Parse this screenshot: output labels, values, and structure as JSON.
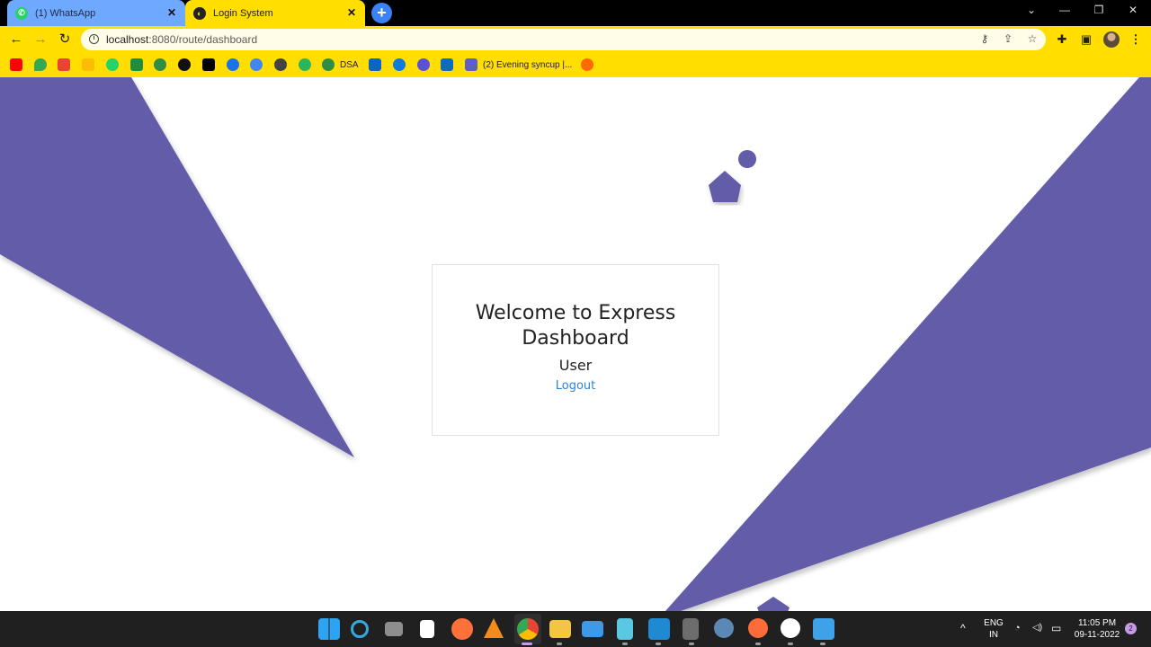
{
  "browser": {
    "tabs": [
      {
        "label": "(1) WhatsApp",
        "close": "✕"
      },
      {
        "label": "Login System",
        "close": "✕"
      }
    ],
    "new_tab": "+",
    "window_controls": {
      "chevron": "⌄",
      "minimize": "—",
      "restore": "❐",
      "close": "✕"
    },
    "nav": {
      "back": "←",
      "forward": "→",
      "reload": "↻"
    },
    "url_host": "localhost",
    "url_path": ":8080/route/dashboard",
    "omnibox_icons": {
      "key": "⚷",
      "share": "⇪",
      "star": "☆"
    },
    "toolbar_icons": {
      "extensions": "✚",
      "sidepanel": "▣"
    },
    "bookmarks": [
      {
        "name": "youtube",
        "color": "#ff0000"
      },
      {
        "name": "maps",
        "color": "#34a853"
      },
      {
        "name": "gmail",
        "color": "#ea4335"
      },
      {
        "name": "drive",
        "color": "#fbbc04"
      },
      {
        "name": "whatsapp",
        "color": "#25d366"
      },
      {
        "name": "classroom",
        "color": "#1e8e3e"
      },
      {
        "name": "gfg",
        "color": "#2f8d46"
      },
      {
        "name": "github",
        "color": "#111111"
      },
      {
        "name": "hackerrank",
        "color": "#000000"
      },
      {
        "name": "codechef",
        "color": "#1a73e8"
      },
      {
        "name": "webapp",
        "color": "#4285f4"
      },
      {
        "name": "idea",
        "color": "#444444"
      },
      {
        "name": "leetcode",
        "color": "#2db55d"
      },
      {
        "name": "gfg-dsa",
        "color": "#2f8d46",
        "label": "DSA"
      },
      {
        "name": "linkedin",
        "color": "#0a66c2"
      },
      {
        "name": "edge",
        "color": "#0c7bdc"
      },
      {
        "name": "messenger",
        "color": "#5b51d8"
      },
      {
        "name": "outlook",
        "color": "#0f6cbd"
      },
      {
        "name": "teams",
        "color": "#5b5fc7",
        "label": "(2) Evening syncup |..."
      },
      {
        "name": "fish",
        "color": "#ff6a00"
      }
    ]
  },
  "page": {
    "title": "Welcome to Express Dashboard",
    "user": "User",
    "logout": "Logout",
    "shape_color": "#625ca9"
  },
  "taskbar": {
    "apps": [
      {
        "name": "start",
        "color": "#2ea3f2"
      },
      {
        "name": "search",
        "color": "#34a8e0"
      },
      {
        "name": "task-view",
        "color": "#8e8e8e"
      },
      {
        "name": "notepad",
        "color": "#ffffff"
      },
      {
        "name": "firefox",
        "color": "#ff7139"
      },
      {
        "name": "vlc",
        "color": "#f48a18"
      },
      {
        "name": "chrome",
        "color": "#e94335"
      },
      {
        "name": "file-explorer",
        "color": "#f4c542"
      },
      {
        "name": "mail",
        "color": "#3c9ae8"
      },
      {
        "name": "notepad-plus",
        "color": "#5ac8e0"
      },
      {
        "name": "vscode",
        "color": "#1f8ad2"
      },
      {
        "name": "calculator",
        "color": "#6d6d6d"
      },
      {
        "name": "mysql",
        "color": "#5b88b5"
      },
      {
        "name": "postman",
        "color": "#ff6c37"
      },
      {
        "name": "mongodb",
        "color": "#ffffff"
      },
      {
        "name": "photos",
        "color": "#3fa2e8"
      }
    ],
    "tray": {
      "chevron": "^",
      "lang_1": "ENG",
      "lang_2": "IN",
      "wifi": "◔",
      "volume": "◁)",
      "battery": "▭",
      "time": "11:05 PM",
      "date": "09-11-2022",
      "notifications": "2"
    }
  }
}
